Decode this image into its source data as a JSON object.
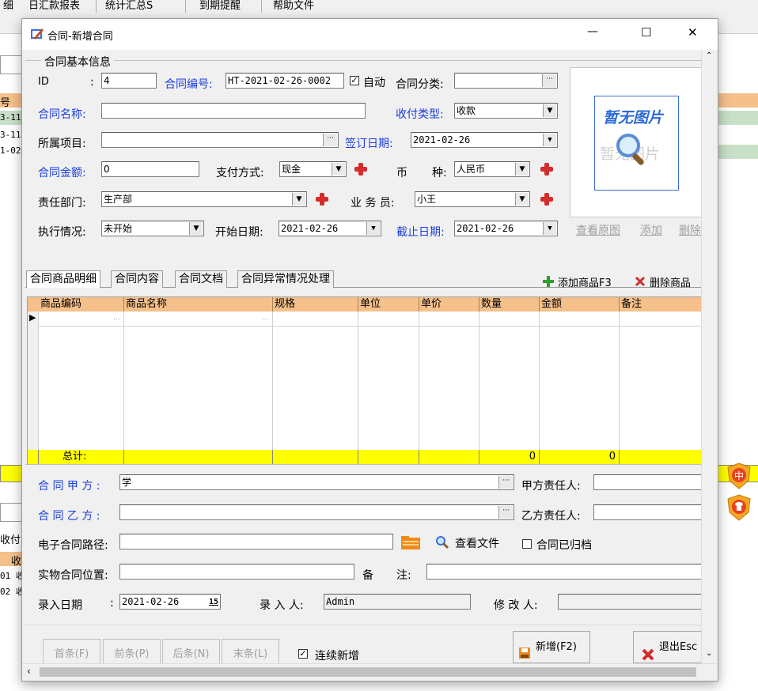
{
  "background": {
    "menus": [
      "细",
      "日汇款报表",
      "统计汇总S",
      "到期提醒",
      "帮助文件"
    ],
    "left_strip": [
      "号",
      "3-11",
      "3-11",
      "1-02"
    ],
    "left_bottom": [
      "收付",
      "收",
      "01 收",
      "02 收"
    ],
    "badges": [
      "中"
    ]
  },
  "dialog": {
    "title": "合同-新增合同",
    "window_controls": {
      "minimize": "—",
      "maximize": "☐",
      "close": "✕"
    },
    "basic_group": "合同基本信息",
    "fields": {
      "id_label": "ID",
      "id_colon": ":",
      "id_value": "4",
      "contract_no_label": "合同编号:",
      "contract_no_value": "HT-2021-02-26-0002",
      "auto_label": "自动",
      "category_label": "合同分类:",
      "category_value": "",
      "name_label": "合同名称:",
      "name_value": "",
      "pay_type_label": "收付类型:",
      "pay_type_value": "收款",
      "project_label": "所属项目:",
      "project_value": "",
      "sign_date_label": "签订日期:",
      "sign_date_value": "2021-02-26",
      "amount_label": "合同金额:",
      "amount_value": "0",
      "pay_method_label": "支付方式:",
      "pay_method_value": "现金",
      "currency_label_1": "币",
      "currency_label_2": "种:",
      "currency_value": "人民币",
      "dept_label": "责任部门:",
      "dept_value": "生产部",
      "staff_label": "业 务 员:",
      "staff_value": "小王",
      "status_label": "执行情况:",
      "status_value": "未开始",
      "start_date_label": "开始日期:",
      "start_date_value": "2021-02-26",
      "end_date_label": "截止日期:",
      "end_date_value": "2021-02-26"
    },
    "image": {
      "placeholder_title": "暂无图片",
      "placeholder_sub": "暂无图片",
      "view_original": "查看原图",
      "add": "添加",
      "delete": "删除"
    },
    "tabs": [
      "合同商品明细",
      "合同内容",
      "合同文档",
      "合同异常情况处理"
    ],
    "grid_actions": {
      "add": "添加商品F3",
      "delete": "删除商品"
    },
    "grid": {
      "columns": [
        "商品编码",
        "商品名称",
        "规格",
        "单位",
        "单价",
        "数量",
        "金额",
        "备注"
      ],
      "total_label": "总计:",
      "total_qty": "0",
      "total_amount": "0",
      "row_marker": "▶",
      "ellipsis": "..."
    },
    "parties": {
      "party_a_label": "合 同 甲 方 :",
      "party_a_value": "学",
      "party_a_resp_label": "甲方责任人:",
      "party_a_resp_value": "",
      "party_b_label": "合 同 乙 方 :",
      "party_b_value": "",
      "party_b_resp_label": "乙方责任人:",
      "party_b_resp_value": "",
      "econtract_label": "电子合同路径:",
      "econtract_value": "",
      "view_file": "查看文件",
      "archived_label": "合同已归档",
      "physical_label": "实物合同位置:",
      "physical_value": "",
      "remark_label_1": "备",
      "remark_label_2": "注:",
      "remark_value": "",
      "entry_date_label": "录入日期",
      "entry_date_colon": ":",
      "entry_date_value": "2021-02-26",
      "entry_date_cal": "15",
      "entered_by_label": "录 入 人:",
      "entered_by_value": "Admin",
      "modified_by_label": "修 改 人:",
      "modified_by_value": ""
    },
    "buttons": {
      "first": "首条(F)",
      "prev": "前条(P)",
      "next": "后条(N)",
      "last": "末条(L)",
      "continuous_add": "连续新增",
      "new": "新增(F2)",
      "exit": "退出Esc"
    },
    "colors": {
      "blue_label": "#1a3de0",
      "grid_header": "#f5c08a",
      "grid_total": "#ffff00",
      "delete_red": "#d42b2b",
      "add_green": "#2ca02c"
    }
  }
}
